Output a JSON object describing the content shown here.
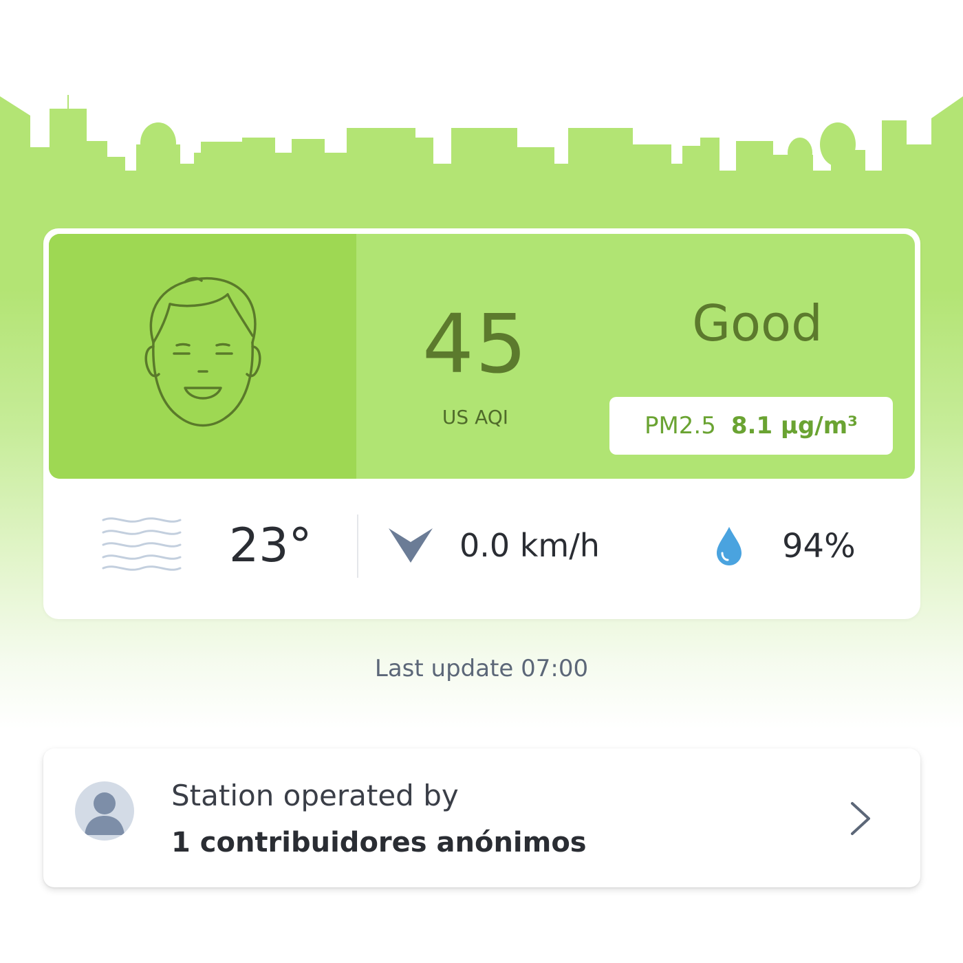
{
  "aqi": {
    "value": "45",
    "label": "US AQI",
    "status": "Good",
    "pollutant": "PM2.5",
    "concentration": "8.1 µg/m³"
  },
  "weather": {
    "temperature": "23°",
    "wind": "0.0 km/h",
    "humidity": "94%"
  },
  "last_update": "Last update 07:00",
  "station": {
    "title": "Station operated by",
    "operator": "1 contribuidores anónimos"
  },
  "colors": {
    "good_green": "#b0e473",
    "face_panel": "#9ed853",
    "text_dark_green": "#5c7a2d"
  },
  "icons": {
    "face": "smiling-face-icon",
    "wind": "wind-waves-icon",
    "wind_direction": "wind-direction-arrow-icon",
    "humidity": "water-drop-icon",
    "avatar": "user-avatar-icon",
    "chevron": "chevron-right-icon"
  }
}
